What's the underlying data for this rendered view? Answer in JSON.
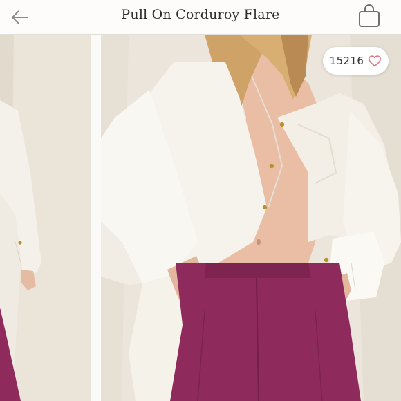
{
  "header": {
    "back_icon": "arrow-left-icon",
    "title": "Pull On Corduroy Flare",
    "bag_icon": "shopping-bag-icon"
  },
  "gallery": {
    "images": [
      {
        "label": "product photo (partial)"
      },
      {
        "label": "main product photo"
      }
    ]
  },
  "likes": {
    "count": "15216",
    "icon": "heart-outline-icon",
    "accent": "#e07a86"
  },
  "colors": {
    "pants": "#8e2a5c",
    "shirt": "#f6f3ec",
    "backdrop": "#ebe5db"
  }
}
